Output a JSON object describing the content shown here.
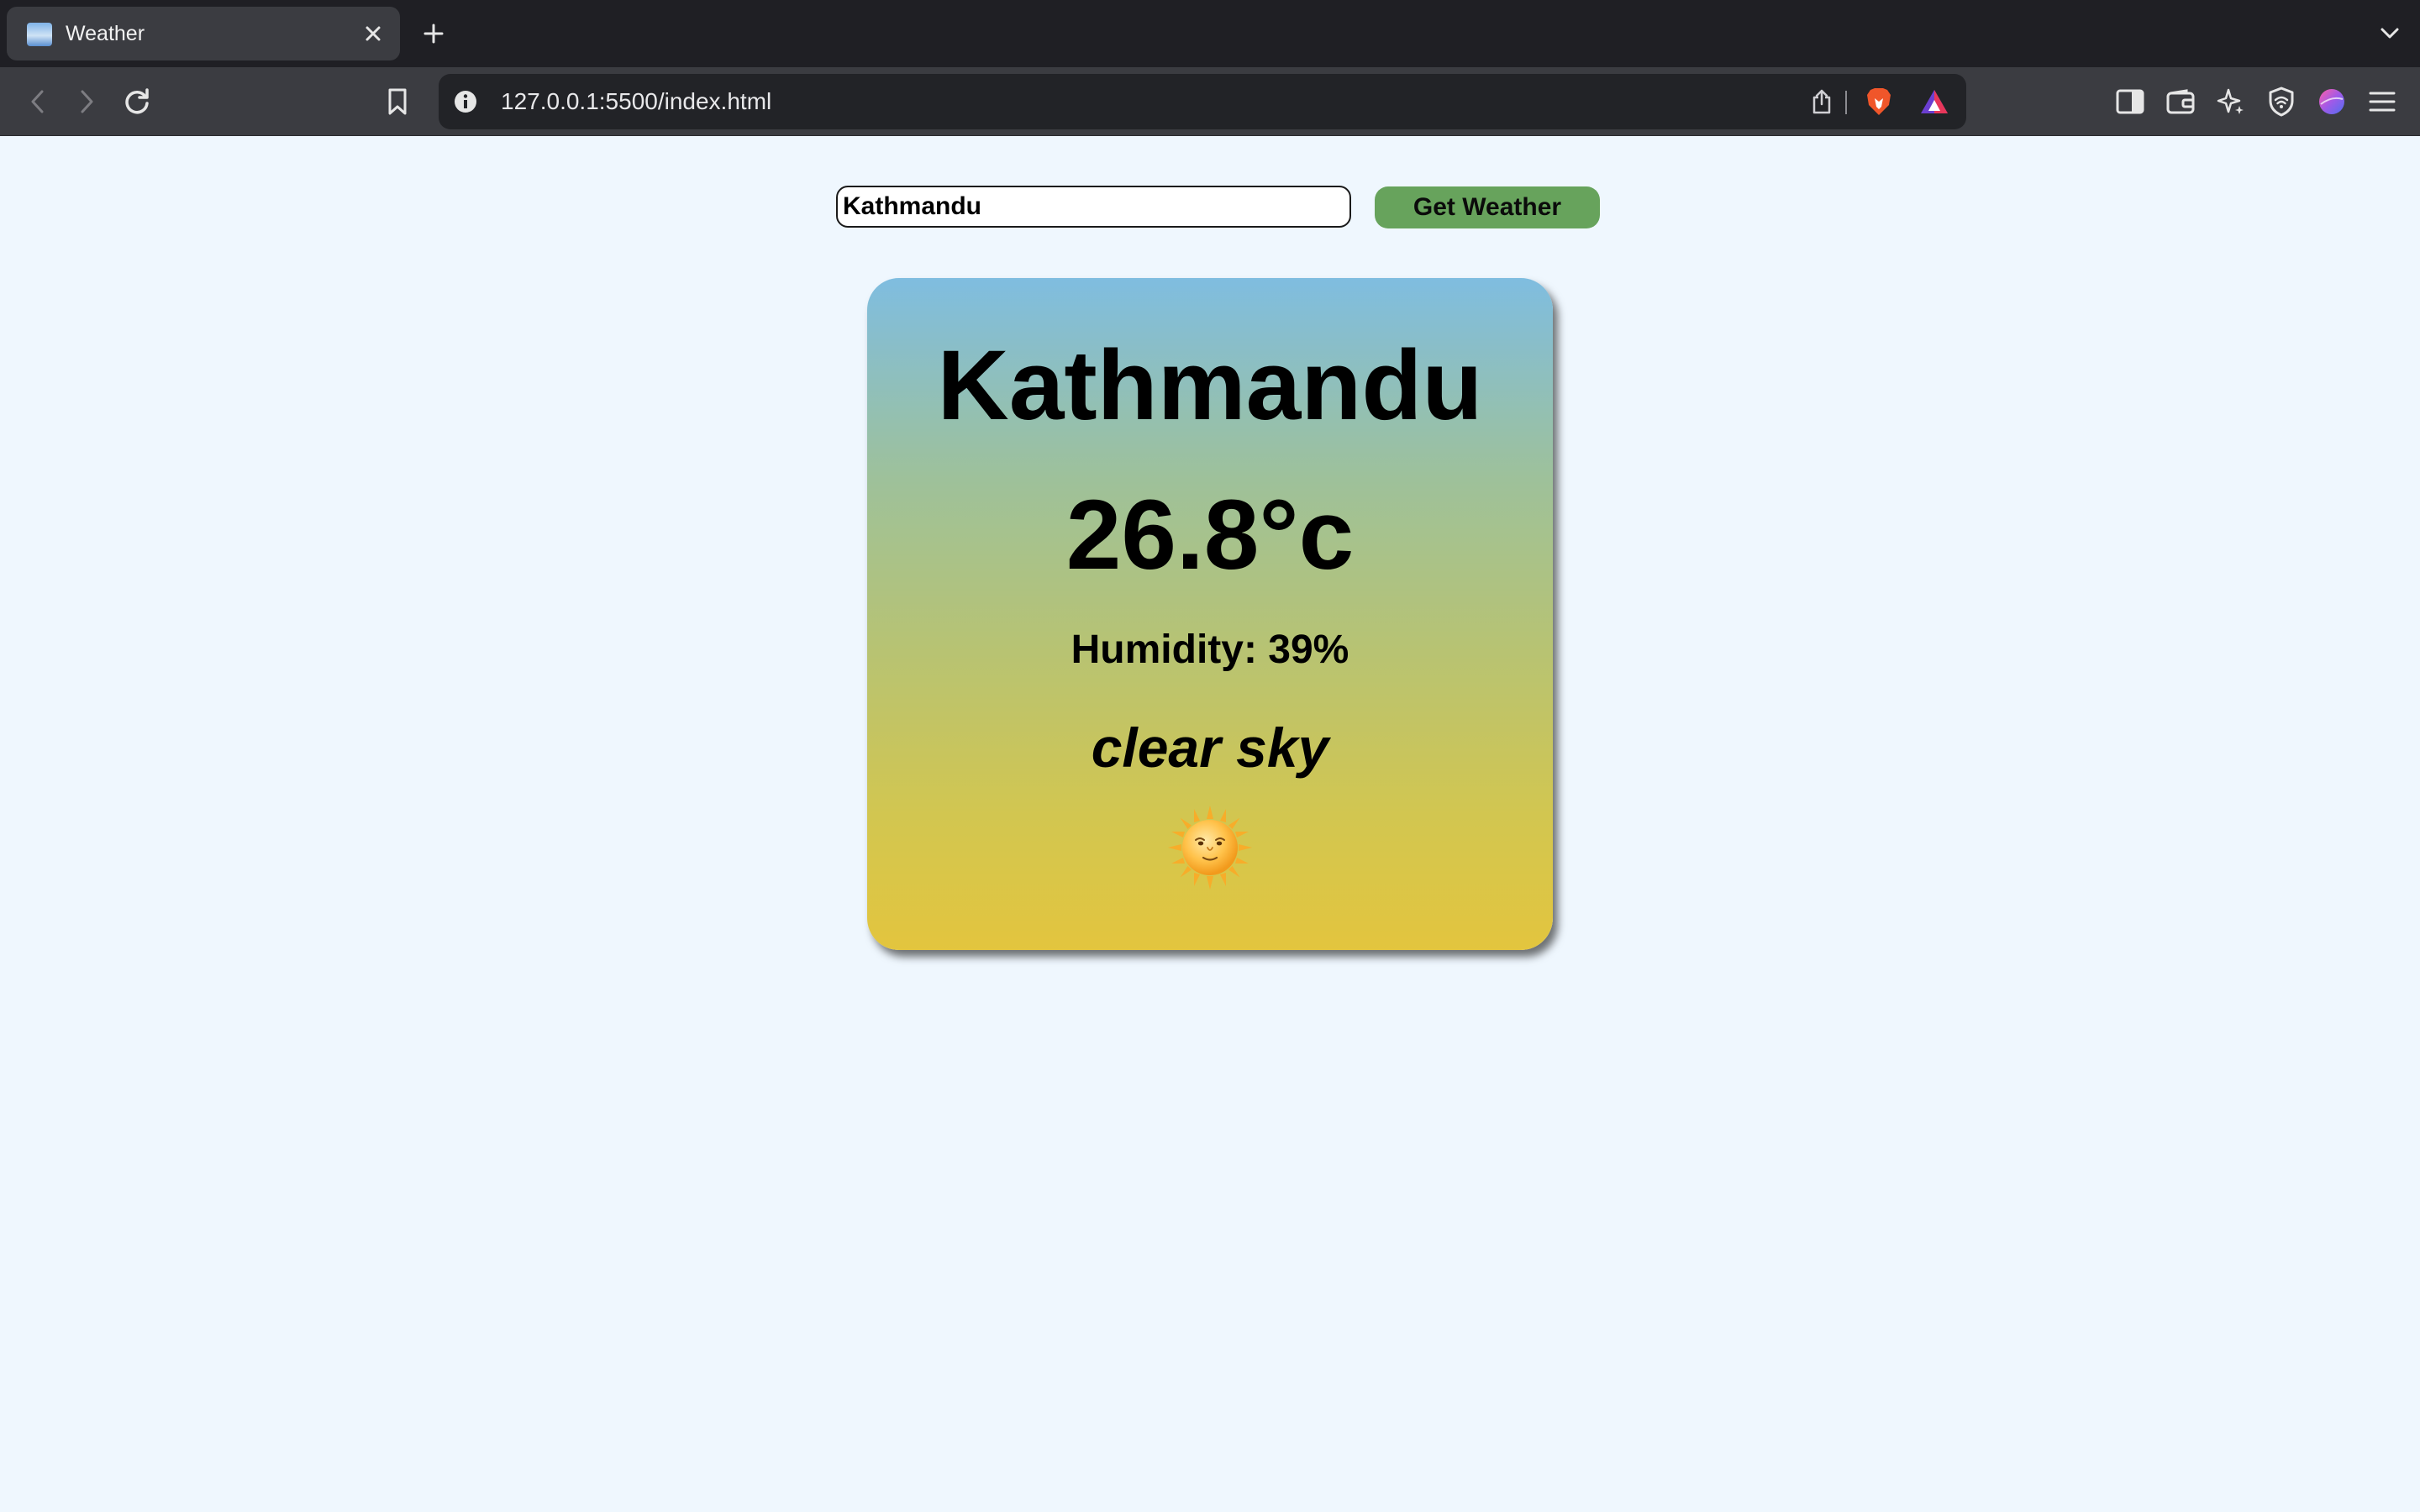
{
  "browser": {
    "tab": {
      "title": "Weather",
      "favicon": "weather-favicon-icon"
    },
    "url": "127.0.0.1:5500/index.html",
    "icons": {
      "tab_close": "close-icon",
      "new_tab": "plus-icon",
      "tab_list": "chevron-down-icon",
      "back": "back-arrow-icon",
      "forward": "forward-arrow-icon",
      "reload": "reload-icon",
      "bookmark": "bookmark-icon",
      "site_info": "info-icon",
      "share": "share-icon",
      "brave_shields": "brave-lion-icon",
      "brave_rewards": "rewards-triangle-icon",
      "sidebar": "sidebar-icon",
      "wallet": "wallet-icon",
      "leo_ai": "sparkle-icon",
      "vpn": "vpn-shield-icon",
      "profile": "profile-avatar-icon",
      "menu": "hamburger-menu-icon"
    }
  },
  "search": {
    "value": "Kathmandu",
    "button_label": "Get Weather"
  },
  "weather": {
    "city": "Kathmandu",
    "temperature": "26.8°c",
    "humidity": "Humidity: 39%",
    "description": "clear sky",
    "icon": "sun-with-face-icon"
  },
  "colors": {
    "page_background": "#eff7fe",
    "button": "#67a35c",
    "card_gradient_top": "#7fbde0",
    "card_gradient_bottom": "#e3c53e"
  }
}
